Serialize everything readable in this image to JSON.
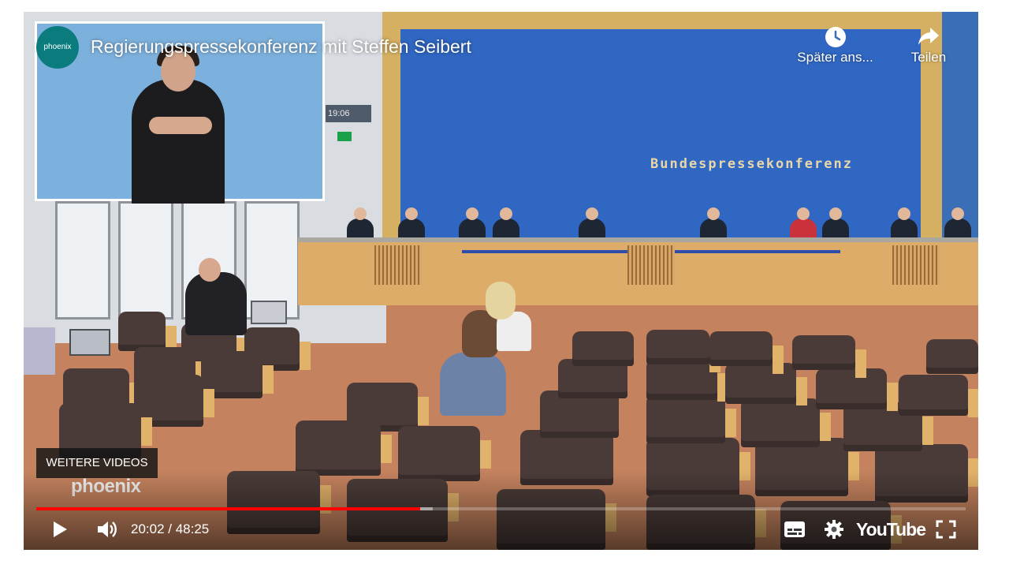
{
  "video": {
    "title": "Regierungspressekonferenz mit Steffen Seibert",
    "channel_logo_text": "phoenix",
    "scene_clock": "19:06",
    "scene_sign": "Bundespressekonferenz"
  },
  "top_actions": {
    "watch_later": {
      "label": "Später ans...",
      "icon": "clock-icon"
    },
    "share": {
      "label": "Teilen",
      "icon": "share-arrow-icon"
    }
  },
  "overlay": {
    "more_videos": "WEITERE VIDEOS",
    "watermark": "phoenix"
  },
  "controls": {
    "current_time": "20:02",
    "separator": " / ",
    "duration": "48:25",
    "played_fraction": 0.413,
    "buffered_fraction": 0.427,
    "youtube_logo": "YouTube",
    "icons": [
      "play-icon",
      "volume-icon",
      "subtitles-icon",
      "settings-gear-icon",
      "youtube-logo",
      "fullscreen-icon"
    ]
  },
  "colors": {
    "progress_played": "#ff0000",
    "channel_logo_bg": "#0a7c7e",
    "wall_blue": "#2f67c3"
  }
}
